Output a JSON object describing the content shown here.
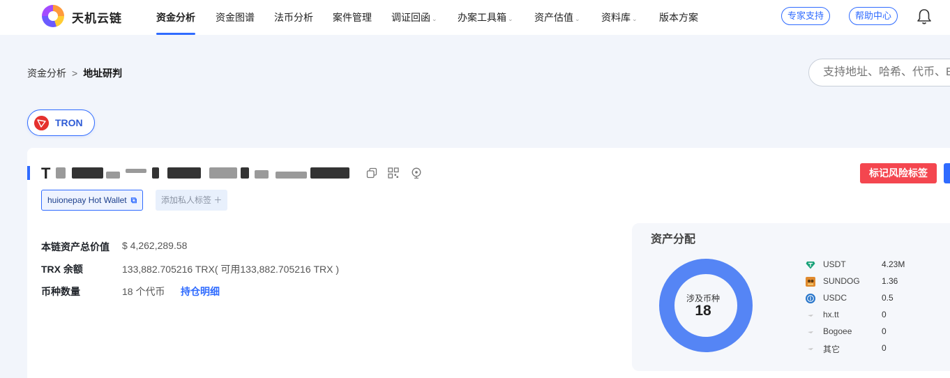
{
  "brand": {
    "name": "天机云链",
    "logo_icon": "tianji-logo-icon"
  },
  "nav": {
    "items": [
      {
        "label": "资金分析",
        "active": true,
        "dropdown": false
      },
      {
        "label": "资金图谱",
        "active": false,
        "dropdown": false
      },
      {
        "label": "法币分析",
        "active": false,
        "dropdown": false
      },
      {
        "label": "案件管理",
        "active": false,
        "dropdown": false
      },
      {
        "label": "调证回函",
        "active": false,
        "dropdown": true
      },
      {
        "label": "办案工具箱",
        "active": false,
        "dropdown": true
      },
      {
        "label": "资产估值",
        "active": false,
        "dropdown": true
      },
      {
        "label": "资料库",
        "active": false,
        "dropdown": true
      },
      {
        "label": "版本方案",
        "active": false,
        "dropdown": false
      }
    ],
    "expert_support": "专家支持",
    "help_center": "帮助中心",
    "dropdown_caret": "⌄"
  },
  "breadcrumb": {
    "parent": "资金分析",
    "separator": ">",
    "current": "地址研判"
  },
  "search": {
    "placeholder": "支持地址、哈希、代币、E"
  },
  "chain": {
    "label": "TRON",
    "icon": "tron-icon",
    "icon_color": "#e5312e"
  },
  "address": {
    "visible_prefix": "T",
    "redacted": true
  },
  "actions": {
    "risk_tag": "标记风险标签",
    "risk_color": "#f4464f"
  },
  "tags": {
    "wallet_label": "huionepay Hot Wallet",
    "add_private": "添加私人标签 ＋"
  },
  "info": {
    "total_value_label": "本链资产总价值",
    "total_value": "$ 4,262,289.58",
    "trx_label": "TRX 余额",
    "trx_value": "133,882.705216 TRX( 可用133,882.705216 TRX )",
    "token_count_label": "币种数量",
    "token_count_value": "18 个代币",
    "holdings_link": "持仓明细"
  },
  "asset_distribution": {
    "title": "资产分配",
    "center_label": "涉及币种",
    "center_value": "18",
    "accent_color": "#5585f5",
    "legend": [
      {
        "name": "USDT",
        "value": "4.23M",
        "icon": "usdt-icon"
      },
      {
        "name": "SUNDOG",
        "value": "1.36",
        "icon": "sundog-icon"
      },
      {
        "name": "USDC",
        "value": "0.5",
        "icon": "usdc-icon"
      },
      {
        "name": "hx.tt",
        "value": "0",
        "icon": "hx-tt-icon"
      },
      {
        "name": "Bogoee",
        "value": "0",
        "icon": "bogoee-icon"
      },
      {
        "name": "其它",
        "value": "0",
        "icon": "other-token-icon"
      }
    ]
  }
}
